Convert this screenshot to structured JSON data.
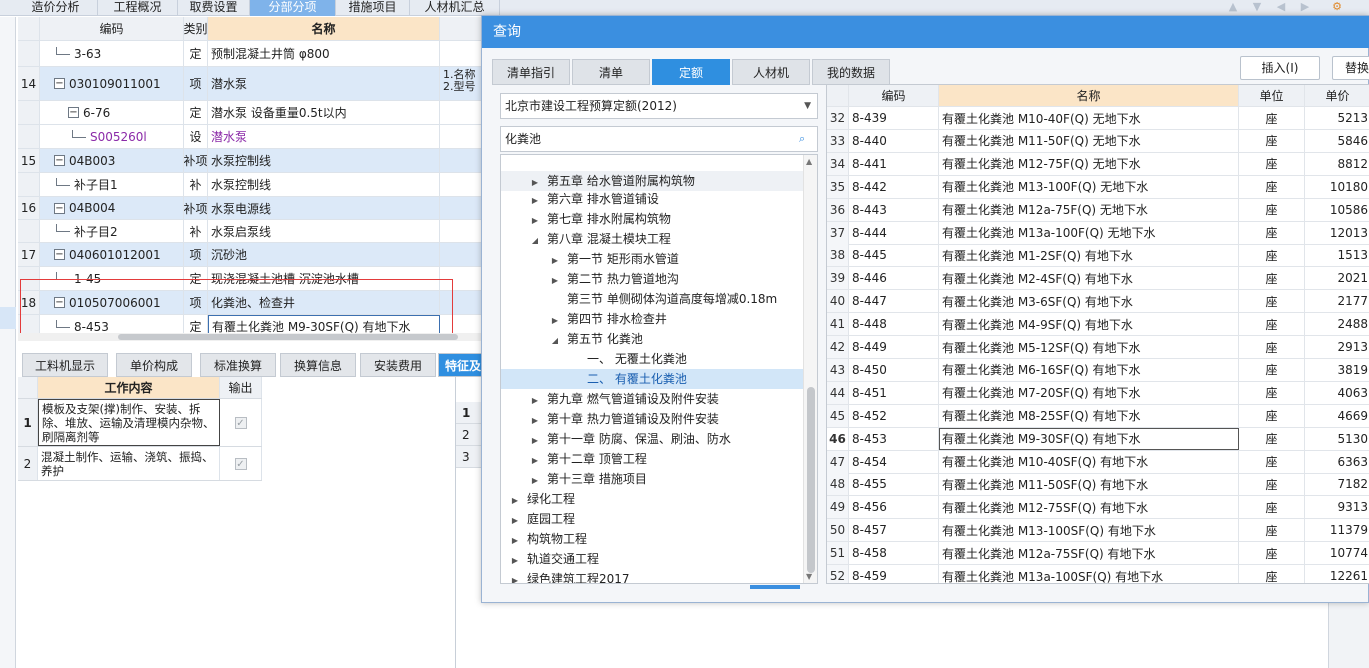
{
  "top_tabs": [
    {
      "label": "造价分析"
    },
    {
      "label": "工程概况"
    },
    {
      "label": "取费设置"
    },
    {
      "label": "分部分项"
    },
    {
      "label": "措施项目"
    },
    {
      "label": "人材机汇总"
    }
  ],
  "main_table": {
    "headers": {
      "code": "编码",
      "type": "类别",
      "name": "名称"
    },
    "rows": [
      {
        "num": "",
        "code": "3-63",
        "type": "定",
        "name": "预制混凝土井筒 φ800",
        "desc": ""
      },
      {
        "num": "14",
        "code": "030109011001",
        "type": "项",
        "name": "潜水泵",
        "desc": "1.名称\n2.型号"
      },
      {
        "num": "",
        "code": "6-76",
        "type": "定",
        "name": "潜水泵 设备重量0.5t以内",
        "desc": ""
      },
      {
        "num": "",
        "code": "S005260l",
        "type": "设",
        "name": "潜水泵",
        "desc": ""
      },
      {
        "num": "15",
        "code": "04B003",
        "type": "补项",
        "name": "水泵控制线",
        "desc": ""
      },
      {
        "num": "",
        "code": "补子目1",
        "type": "补",
        "name": "水泵控制线",
        "desc": ""
      },
      {
        "num": "16",
        "code": "04B004",
        "type": "补项",
        "name": "水泵电源线",
        "desc": ""
      },
      {
        "num": "",
        "code": "补子目2",
        "type": "补",
        "name": "水泵启泵线",
        "desc": ""
      },
      {
        "num": "17",
        "code": "040601012001",
        "type": "项",
        "name": "沉砂池",
        "desc": ""
      },
      {
        "num": "",
        "code": "1-45",
        "type": "定",
        "name": "现浇混凝土池槽 沉淀池水槽",
        "desc": ""
      },
      {
        "num": "18",
        "code": "010507006001",
        "type": "项",
        "name": "化粪池、检查井",
        "desc": ""
      },
      {
        "num": "",
        "code": "8-453",
        "type": "定",
        "name": "有覆土化粪池 M9-30SF(Q) 有地下水",
        "desc": ""
      }
    ]
  },
  "lower_tabs": [
    {
      "label": "工料机显示"
    },
    {
      "label": "单价构成"
    },
    {
      "label": "标准换算"
    },
    {
      "label": "换算信息"
    },
    {
      "label": "安装费用"
    },
    {
      "label": "特征及"
    }
  ],
  "work_table": {
    "headers": {
      "content": "工作内容",
      "output": "输出"
    },
    "rows": [
      {
        "num": "1",
        "content": "模板及支架(撑)制作、安装、拆除、堆放、运输及清理模内杂物、刷隔离剂等"
      },
      {
        "num": "2",
        "content": "混凝土制作、运输、浇筑、振捣、养护"
      }
    ]
  },
  "small_table": {
    "rows": [
      "1",
      "2",
      "3"
    ]
  },
  "dialog": {
    "title": "查询",
    "tabs": [
      {
        "label": "清单指引"
      },
      {
        "label": "清单"
      },
      {
        "label": "定额"
      },
      {
        "label": "人材机"
      },
      {
        "label": "我的数据"
      }
    ],
    "buttons": {
      "insert": "插入(I)",
      "replace": "替换"
    },
    "quota_select": "北京市建设工程预算定额(2012)",
    "search_value": "化粪池",
    "tree": [
      {
        "label": "第五章 给水管道附属构筑物",
        "indent": 2,
        "arrow": "right"
      },
      {
        "label": "第六章 排水管道铺设",
        "indent": 2,
        "arrow": "right"
      },
      {
        "label": "第七章 排水附属构筑物",
        "indent": 2,
        "arrow": "right"
      },
      {
        "label": "第八章 混凝土模块工程",
        "indent": 2,
        "arrow": "down"
      },
      {
        "label": "第一节 矩形雨水管道",
        "indent": 3,
        "arrow": "right"
      },
      {
        "label": "第二节 热力管道地沟",
        "indent": 3,
        "arrow": "right"
      },
      {
        "label": "第三节 单侧砌体沟道高度每增减0.18m",
        "indent": 3,
        "arrow": ""
      },
      {
        "label": "第四节 排水检查井",
        "indent": 3,
        "arrow": "right"
      },
      {
        "label": "第五节 化粪池",
        "indent": 3,
        "arrow": "down"
      },
      {
        "label": "一、 无覆土化粪池",
        "indent": 4,
        "arrow": ""
      },
      {
        "label": "二、 有覆土化粪池",
        "indent": 4,
        "arrow": ""
      },
      {
        "label": "第九章 燃气管道铺设及附件安装",
        "indent": 2,
        "arrow": "right"
      },
      {
        "label": "第十章 热力管道铺设及附件安装",
        "indent": 2,
        "arrow": "right"
      },
      {
        "label": "第十一章 防腐、保温、刷油、防水",
        "indent": 2,
        "arrow": "right"
      },
      {
        "label": "第十二章 顶管工程",
        "indent": 2,
        "arrow": "right"
      },
      {
        "label": "第十三章 措施项目",
        "indent": 2,
        "arrow": "right"
      },
      {
        "label": "绿化工程",
        "indent": 1,
        "arrow": "right"
      },
      {
        "label": "庭园工程",
        "indent": 1,
        "arrow": "right"
      },
      {
        "label": "构筑物工程",
        "indent": 1,
        "arrow": "right"
      },
      {
        "label": "轨道交通工程",
        "indent": 1,
        "arrow": "right"
      },
      {
        "label": "绿色建筑工程2017",
        "indent": 1,
        "arrow": "right"
      }
    ],
    "grid": {
      "headers": {
        "code": "编码",
        "name": "名称",
        "unit": "单位",
        "price": "单价"
      },
      "rows": [
        {
          "num": "32",
          "code": "8-439",
          "name": "有覆土化粪池 M10-40F(Q) 无地下水",
          "unit": "座",
          "price": "5213"
        },
        {
          "num": "33",
          "code": "8-440",
          "name": "有覆土化粪池 M11-50F(Q) 无地下水",
          "unit": "座",
          "price": "5846"
        },
        {
          "num": "34",
          "code": "8-441",
          "name": "有覆土化粪池 M12-75F(Q) 无地下水",
          "unit": "座",
          "price": "8812"
        },
        {
          "num": "35",
          "code": "8-442",
          "name": "有覆土化粪池 M13-100F(Q) 无地下水",
          "unit": "座",
          "price": "10180"
        },
        {
          "num": "36",
          "code": "8-443",
          "name": "有覆土化粪池 M12a-75F(Q) 无地下水",
          "unit": "座",
          "price": "10586"
        },
        {
          "num": "37",
          "code": "8-444",
          "name": "有覆土化粪池 M13a-100F(Q) 无地下水",
          "unit": "座",
          "price": "12013"
        },
        {
          "num": "38",
          "code": "8-445",
          "name": "有覆土化粪池 M1-2SF(Q) 有地下水",
          "unit": "座",
          "price": "1513"
        },
        {
          "num": "39",
          "code": "8-446",
          "name": "有覆土化粪池 M2-4SF(Q) 有地下水",
          "unit": "座",
          "price": "2021"
        },
        {
          "num": "40",
          "code": "8-447",
          "name": "有覆土化粪池 M3-6SF(Q) 有地下水",
          "unit": "座",
          "price": "2177"
        },
        {
          "num": "41",
          "code": "8-448",
          "name": "有覆土化粪池 M4-9SF(Q) 有地下水",
          "unit": "座",
          "price": "2488"
        },
        {
          "num": "42",
          "code": "8-449",
          "name": "有覆土化粪池 M5-12SF(Q) 有地下水",
          "unit": "座",
          "price": "2913"
        },
        {
          "num": "43",
          "code": "8-450",
          "name": "有覆土化粪池 M6-16SF(Q) 有地下水",
          "unit": "座",
          "price": "3819"
        },
        {
          "num": "44",
          "code": "8-451",
          "name": "有覆土化粪池 M7-20SF(Q) 有地下水",
          "unit": "座",
          "price": "4063"
        },
        {
          "num": "45",
          "code": "8-452",
          "name": "有覆土化粪池 M8-25SF(Q) 有地下水",
          "unit": "座",
          "price": "4669"
        },
        {
          "num": "46",
          "code": "8-453",
          "name": "有覆土化粪池 M9-30SF(Q) 有地下水",
          "unit": "座",
          "price": "5130"
        },
        {
          "num": "47",
          "code": "8-454",
          "name": "有覆土化粪池 M10-40SF(Q) 有地下水",
          "unit": "座",
          "price": "6363"
        },
        {
          "num": "48",
          "code": "8-455",
          "name": "有覆土化粪池 M11-50SF(Q) 有地下水",
          "unit": "座",
          "price": "7182"
        },
        {
          "num": "49",
          "code": "8-456",
          "name": "有覆土化粪池 M12-75SF(Q) 有地下水",
          "unit": "座",
          "price": "9313"
        },
        {
          "num": "50",
          "code": "8-457",
          "name": "有覆土化粪池 M13-100SF(Q) 有地下水",
          "unit": "座",
          "price": "11379"
        },
        {
          "num": "51",
          "code": "8-458",
          "name": "有覆土化粪池 M12a-75SF(Q) 有地下水",
          "unit": "座",
          "price": "10774"
        },
        {
          "num": "52",
          "code": "8-459",
          "name": "有覆土化粪池 M13a-100SF(Q) 有地下水",
          "unit": "座",
          "price": "12261"
        }
      ]
    }
  },
  "colors": {
    "accent": "#2f8fe0",
    "title_bar": "#3b8fe0",
    "name_header": "#fbe5c7",
    "row_highlight": "#dce9f8",
    "selection_border": "#e33b3b"
  }
}
